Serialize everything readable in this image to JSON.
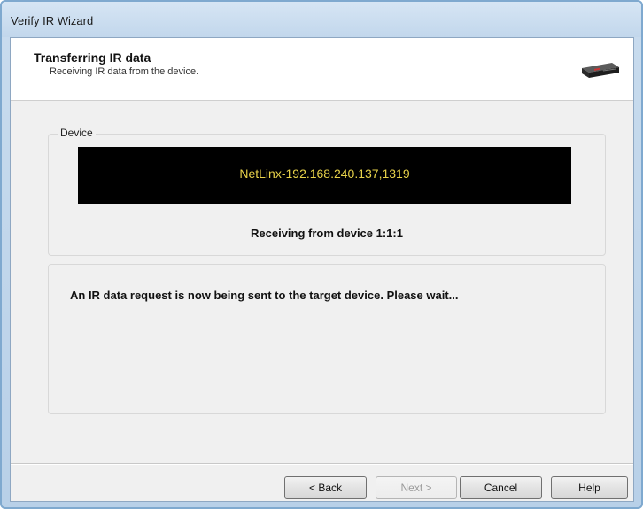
{
  "window": {
    "title": "Verify IR Wizard"
  },
  "header": {
    "title": "Transferring IR data",
    "subtitle": "Receiving IR data from the device.",
    "icon": "device-icon"
  },
  "device_group": {
    "legend": "Device",
    "device_address": "NetLinx-192.168.240.137,1319",
    "status": "Receiving from device 1:1:1"
  },
  "message": {
    "text": "An IR data request is now being sent to the target device. Please wait..."
  },
  "buttons": {
    "back": "< Back",
    "next": "Next >",
    "cancel": "Cancel",
    "help": "Help"
  },
  "colors": {
    "device_text": "#e8d24a",
    "screen_bg": "#000000"
  }
}
